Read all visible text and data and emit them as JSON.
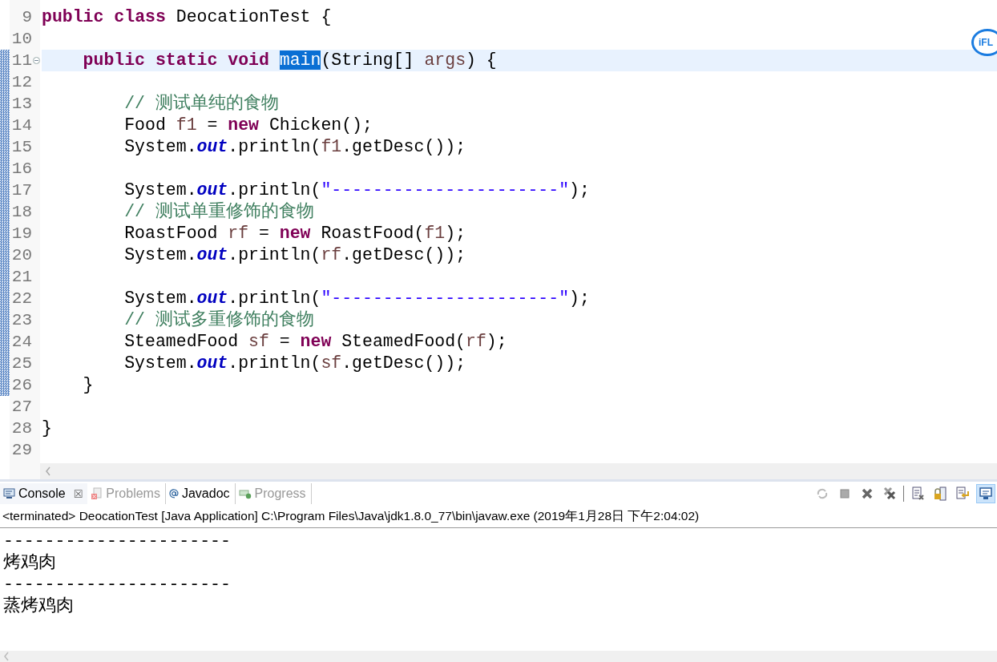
{
  "editor": {
    "lines": [
      {
        "number": "9",
        "current": false,
        "folded_marker": false,
        "changed": false,
        "tokens": [
          {
            "kind": "keyword",
            "text": "public "
          },
          {
            "kind": "keyword",
            "text": "class "
          },
          {
            "kind": "plain",
            "text": "DeocationTest {"
          }
        ]
      },
      {
        "number": "10",
        "current": false,
        "folded_marker": false,
        "changed": false
      },
      {
        "number": "11",
        "current": true,
        "folded_marker": true,
        "changed": true,
        "tokens": [
          {
            "kind": "keyword",
            "text": "    public "
          },
          {
            "kind": "keyword",
            "text": "static "
          },
          {
            "kind": "keyword",
            "text": "void "
          },
          {
            "kind": "selection",
            "text": "main"
          },
          {
            "kind": "plain",
            "text": "(String[] "
          },
          {
            "kind": "variable",
            "text": "args"
          },
          {
            "kind": "plain",
            "text": ") {"
          }
        ]
      },
      {
        "number": "12",
        "current": false,
        "folded_marker": false,
        "changed": true
      },
      {
        "number": "13",
        "current": false,
        "folded_marker": false,
        "changed": true,
        "tokens": [
          {
            "kind": "comment",
            "text": "        // 测试单纯的食物"
          }
        ]
      },
      {
        "number": "14",
        "current": false,
        "folded_marker": false,
        "changed": true,
        "tokens": [
          {
            "kind": "plain",
            "text": "        Food "
          },
          {
            "kind": "variable",
            "text": "f1"
          },
          {
            "kind": "plain",
            "text": " = "
          },
          {
            "kind": "keyword",
            "text": "new "
          },
          {
            "kind": "plain",
            "text": "Chicken();"
          }
        ]
      },
      {
        "number": "15",
        "current": false,
        "folded_marker": false,
        "changed": true,
        "tokens": [
          {
            "kind": "plain",
            "text": "        System."
          },
          {
            "kind": "field",
            "text": "out"
          },
          {
            "kind": "plain",
            "text": ".println("
          },
          {
            "kind": "variable",
            "text": "f1"
          },
          {
            "kind": "plain",
            "text": ".getDesc());"
          }
        ]
      },
      {
        "number": "16",
        "current": false,
        "folded_marker": false,
        "changed": true
      },
      {
        "number": "17",
        "current": false,
        "folded_marker": false,
        "changed": true,
        "tokens": [
          {
            "kind": "plain",
            "text": "        System."
          },
          {
            "kind": "field",
            "text": "out"
          },
          {
            "kind": "plain",
            "text": ".println("
          },
          {
            "kind": "string",
            "text": "\"----------------------\""
          },
          {
            "kind": "plain",
            "text": ");"
          }
        ]
      },
      {
        "number": "18",
        "current": false,
        "folded_marker": false,
        "changed": true,
        "tokens": [
          {
            "kind": "comment",
            "text": "        // 测试单重修饰的食物"
          }
        ]
      },
      {
        "number": "19",
        "current": false,
        "folded_marker": false,
        "changed": true,
        "tokens": [
          {
            "kind": "plain",
            "text": "        RoastFood "
          },
          {
            "kind": "variable",
            "text": "rf"
          },
          {
            "kind": "plain",
            "text": " = "
          },
          {
            "kind": "keyword",
            "text": "new "
          },
          {
            "kind": "plain",
            "text": "RoastFood("
          },
          {
            "kind": "variable",
            "text": "f1"
          },
          {
            "kind": "plain",
            "text": ");"
          }
        ]
      },
      {
        "number": "20",
        "current": false,
        "folded_marker": false,
        "changed": true,
        "tokens": [
          {
            "kind": "plain",
            "text": "        System."
          },
          {
            "kind": "field",
            "text": "out"
          },
          {
            "kind": "plain",
            "text": ".println("
          },
          {
            "kind": "variable",
            "text": "rf"
          },
          {
            "kind": "plain",
            "text": ".getDesc());"
          }
        ]
      },
      {
        "number": "21",
        "current": false,
        "folded_marker": false,
        "changed": true
      },
      {
        "number": "22",
        "current": false,
        "folded_marker": false,
        "changed": true,
        "tokens": [
          {
            "kind": "plain",
            "text": "        System."
          },
          {
            "kind": "field",
            "text": "out"
          },
          {
            "kind": "plain",
            "text": ".println("
          },
          {
            "kind": "string",
            "text": "\"----------------------\""
          },
          {
            "kind": "plain",
            "text": ");"
          }
        ]
      },
      {
        "number": "23",
        "current": false,
        "folded_marker": false,
        "changed": true,
        "tokens": [
          {
            "kind": "comment",
            "text": "        // 测试多重修饰的食物"
          }
        ]
      },
      {
        "number": "24",
        "current": false,
        "folded_marker": false,
        "changed": true,
        "tokens": [
          {
            "kind": "plain",
            "text": "        SteamedFood "
          },
          {
            "kind": "variable",
            "text": "sf"
          },
          {
            "kind": "plain",
            "text": " = "
          },
          {
            "kind": "keyword",
            "text": "new "
          },
          {
            "kind": "plain",
            "text": "SteamedFood("
          },
          {
            "kind": "variable",
            "text": "rf"
          },
          {
            "kind": "plain",
            "text": ");"
          }
        ]
      },
      {
        "number": "25",
        "current": false,
        "folded_marker": false,
        "changed": true,
        "tokens": [
          {
            "kind": "plain",
            "text": "        System."
          },
          {
            "kind": "field",
            "text": "out"
          },
          {
            "kind": "plain",
            "text": ".println("
          },
          {
            "kind": "variable",
            "text": "sf"
          },
          {
            "kind": "plain",
            "text": ".getDesc());"
          }
        ]
      },
      {
        "number": "26",
        "current": false,
        "folded_marker": false,
        "changed": true,
        "tokens": [
          {
            "kind": "plain",
            "text": "    }"
          }
        ]
      },
      {
        "number": "27",
        "current": false,
        "folded_marker": false,
        "changed": false
      },
      {
        "number": "28",
        "current": false,
        "folded_marker": false,
        "changed": false,
        "tokens": [
          {
            "kind": "plain",
            "text": "}"
          }
        ]
      },
      {
        "number": "29",
        "current": false,
        "folded_marker": false,
        "changed": false
      }
    ]
  },
  "floating_widget": {
    "label": "iFL"
  },
  "console": {
    "tabs": [
      {
        "label": "Console",
        "selected": true,
        "dimmed": false,
        "kind": "console"
      },
      {
        "label": "Problems",
        "selected": false,
        "dimmed": true,
        "kind": "problems"
      },
      {
        "label": "Javadoc",
        "selected": false,
        "dimmed": false,
        "kind": "javadoc"
      },
      {
        "label": "Progress",
        "selected": false,
        "dimmed": true,
        "kind": "progress"
      }
    ],
    "close_glyph": "☒",
    "toolbar": [
      {
        "kind": "sync",
        "selected": false
      },
      {
        "kind": "stop",
        "selected": false
      },
      {
        "kind": "remove",
        "selected": false
      },
      {
        "kind": "remove-all",
        "selected": false
      },
      {
        "kind": "clear",
        "selected": false
      },
      {
        "kind": "scroll-lock",
        "selected": false
      },
      {
        "kind": "word-wrap",
        "selected": false
      },
      {
        "kind": "display",
        "selected": true
      }
    ],
    "header": "<terminated> DeocationTest [Java Application] C:\\Program Files\\Java\\jdk1.8.0_77\\bin\\javaw.exe (2019年1月28日 下午2:04:02)",
    "output": [
      "----------------------",
      "烤鸡肉",
      "----------------------",
      "蒸烤鸡肉"
    ]
  }
}
